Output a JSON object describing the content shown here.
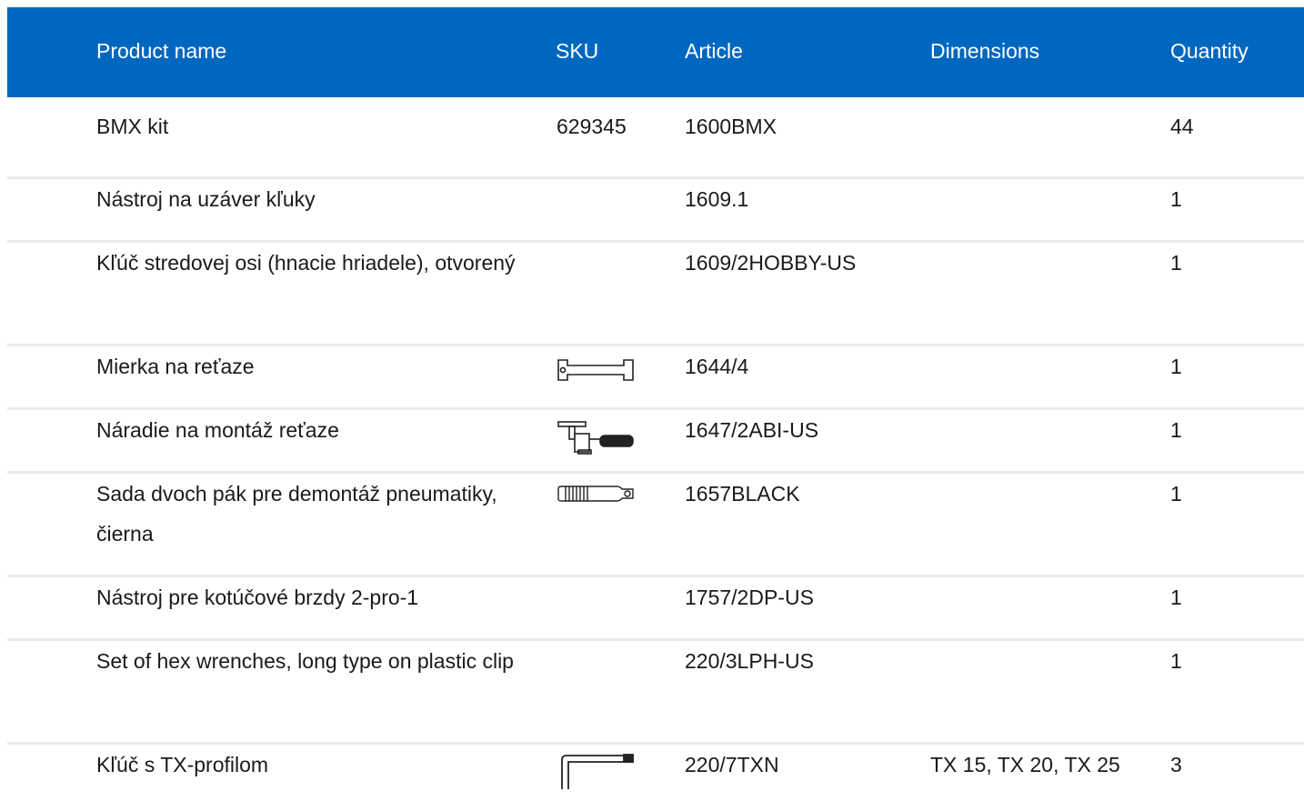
{
  "header": {
    "product_name": "Product name",
    "sku": "SKU",
    "article": "Article",
    "dimensions": "Dimensions",
    "quantity": "Quantity"
  },
  "rows": [
    {
      "name": "BMX kit",
      "sku": "629345",
      "article": "1600BMX",
      "dimensions": "",
      "quantity": "44",
      "icon": ""
    },
    {
      "name": "Nástroj na uzáver kľuky",
      "sku": "",
      "article": "1609.1",
      "dimensions": "",
      "quantity": "1",
      "icon": ""
    },
    {
      "name": "Kľúč stredovej osi (hnacie hriadele), otvorený",
      "sku": "",
      "article": "1609/2HOBBY-US",
      "dimensions": "",
      "quantity": "1",
      "icon": ""
    },
    {
      "name": "Mierka na reťaze",
      "sku": "",
      "article": "1644/4",
      "dimensions": "",
      "quantity": "1",
      "icon": "chain-gauge-icon"
    },
    {
      "name": "Náradie na montáž reťaze",
      "sku": "",
      "article": "1647/2ABI-US",
      "dimensions": "",
      "quantity": "1",
      "icon": "chain-tool-icon"
    },
    {
      "name": "Sada dvoch pák pre demontáž pneumatiky, čierna",
      "sku": "",
      "article": "1657BLACK",
      "dimensions": "",
      "quantity": "1",
      "icon": "tire-lever-icon"
    },
    {
      "name": "Nástroj pre kotúčové brzdy 2-pro-1",
      "sku": "",
      "article": "1757/2DP-US",
      "dimensions": "",
      "quantity": "1",
      "icon": ""
    },
    {
      "name": "Set of hex wrenches, long type on plastic clip",
      "sku": "",
      "article": "220/3LPH-US",
      "dimensions": "",
      "quantity": "1",
      "icon": ""
    },
    {
      "name": "Kľúč s TX-profilom",
      "sku": "",
      "article": "220/7TXN",
      "dimensions": "TX 15, TX 20, TX 25",
      "quantity": "3",
      "icon": "torx-key-icon"
    }
  ],
  "colors": {
    "header_bg": "#0067c0",
    "header_text": "#ffffff",
    "row_divider": "#ebebeb"
  }
}
